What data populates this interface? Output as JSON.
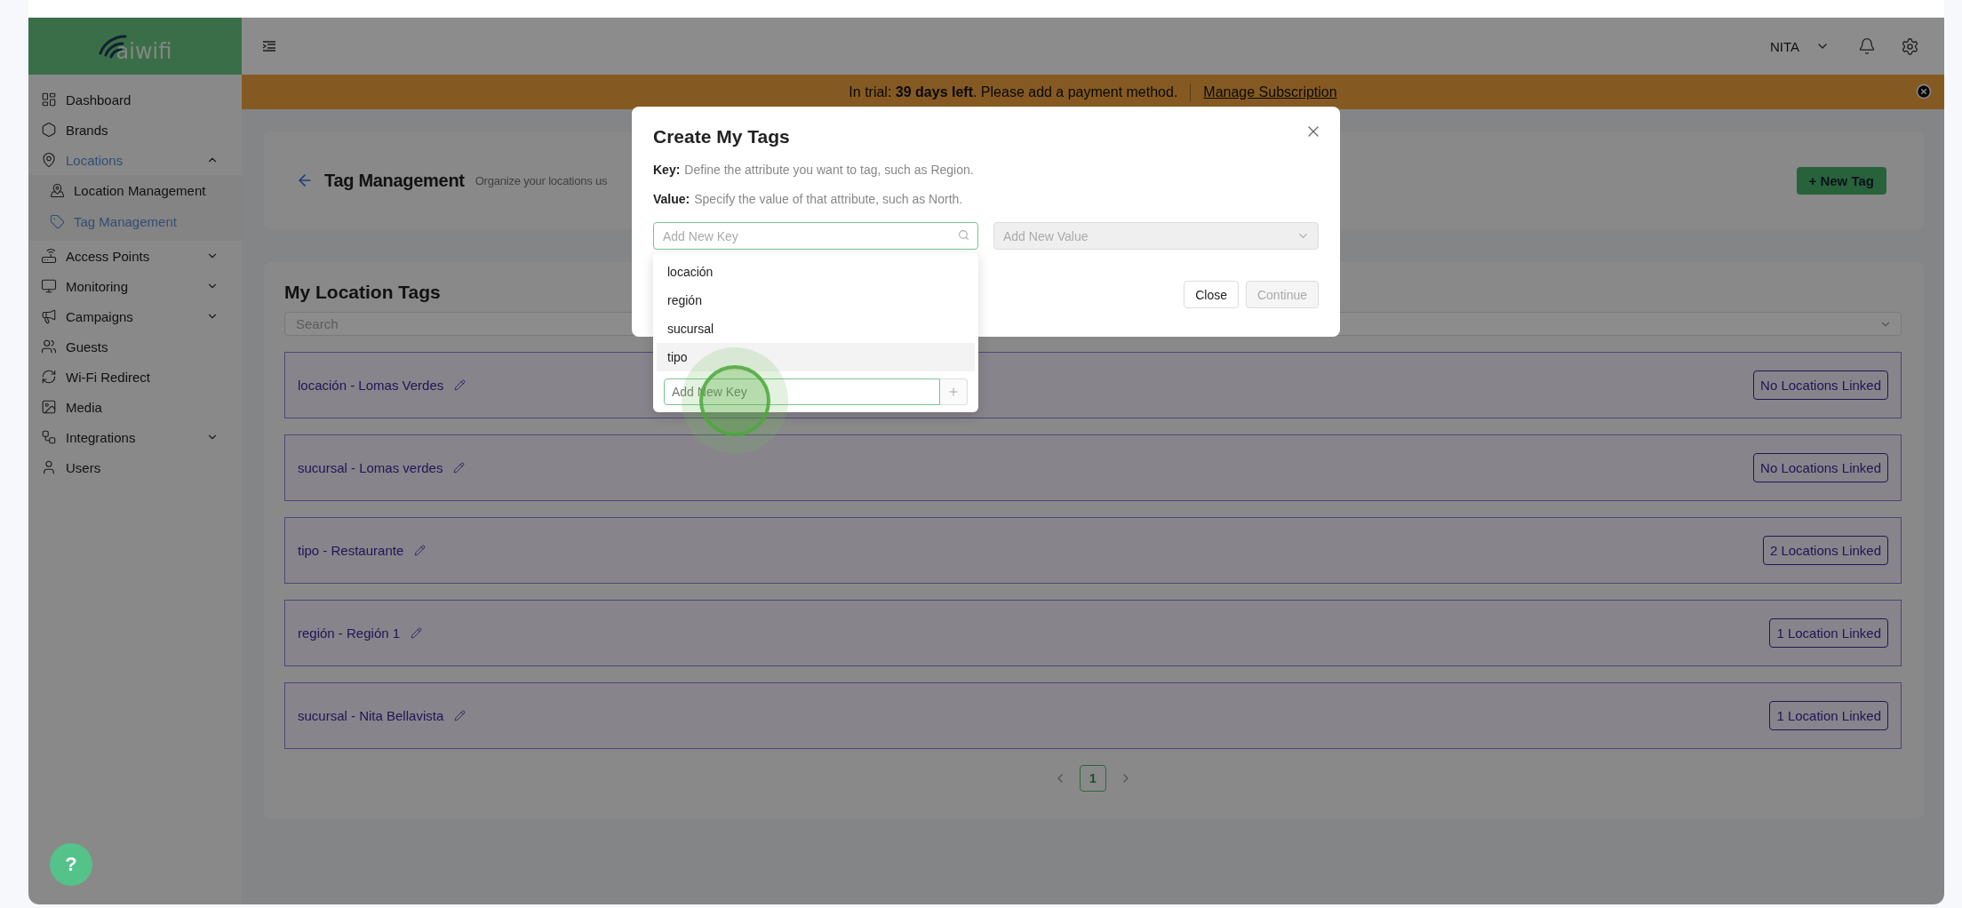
{
  "logo": {
    "text": "aiwifi"
  },
  "sidebar": {
    "items": [
      {
        "label": "Dashboard",
        "selected": false
      },
      {
        "label": "Brands",
        "selected": false
      },
      {
        "label": "Locations",
        "selected": true,
        "expanded": true,
        "children": [
          {
            "label": "Location Management",
            "selected": false
          },
          {
            "label": "Tag Management",
            "selected": true
          }
        ]
      },
      {
        "label": "Access Points",
        "selected": false,
        "expanded": false
      },
      {
        "label": "Monitoring",
        "selected": false,
        "expanded": false
      },
      {
        "label": "Campaigns",
        "selected": false,
        "expanded": false
      },
      {
        "label": "Guests",
        "selected": false
      },
      {
        "label": "Wi-Fi Redirect",
        "selected": false
      },
      {
        "label": "Media",
        "selected": false
      },
      {
        "label": "Integrations",
        "selected": false,
        "expanded": false
      },
      {
        "label": "Users",
        "selected": false
      }
    ]
  },
  "header": {
    "user": "NITA"
  },
  "banner": {
    "text": "In trial: **39 days left**. Please add a payment method.",
    "link": "Manage Subscription"
  },
  "page_header": {
    "title": "Tag Management",
    "subtitle": "Organize your locations us",
    "new_tag_button": "+ New Tag"
  },
  "tags_card": {
    "title": "My Location Tags",
    "search": {
      "placeholder": "Search"
    },
    "tags": [
      {
        "label": "locación - Lomas Verdes",
        "badge": "No Locations Linked"
      },
      {
        "label": "sucursal - Lomas verdes",
        "badge": "No Locations Linked"
      },
      {
        "label": "tipo - Restaurante",
        "badge": "2 Locations Linked"
      },
      {
        "label": "región - Región 1",
        "badge": "1 Location Linked"
      },
      {
        "label": "sucursal - Nita Bellavista",
        "badge": "1 Location Linked"
      }
    ],
    "pagination": {
      "pages": [
        {
          "label": "1",
          "selected": true
        }
      ]
    }
  },
  "modal": {
    "title": "Create My Tags",
    "hints": [
      {
        "term": "Key:",
        "text": "Define the attribute you want to tag, such as Region."
      },
      {
        "term": "Value:",
        "text": "Specify the value of that attribute, such as North."
      }
    ],
    "key_field": {
      "placeholder": "Add New Key"
    },
    "value_field": {
      "placeholder": "Add New Value",
      "disabled": true
    },
    "key_options": [
      {
        "label": "locación",
        "highlighted": false
      },
      {
        "label": "región",
        "highlighted": false
      },
      {
        "label": "sucursal",
        "highlighted": false
      },
      {
        "label": "tipo",
        "highlighted": true
      }
    ],
    "new_key_field": {
      "placeholder": "Add New Key"
    },
    "buttons": [
      {
        "label": "Close",
        "disabled": false
      },
      {
        "label": "Continue",
        "disabled": true
      }
    ]
  },
  "help_button": {
    "label": "?"
  }
}
